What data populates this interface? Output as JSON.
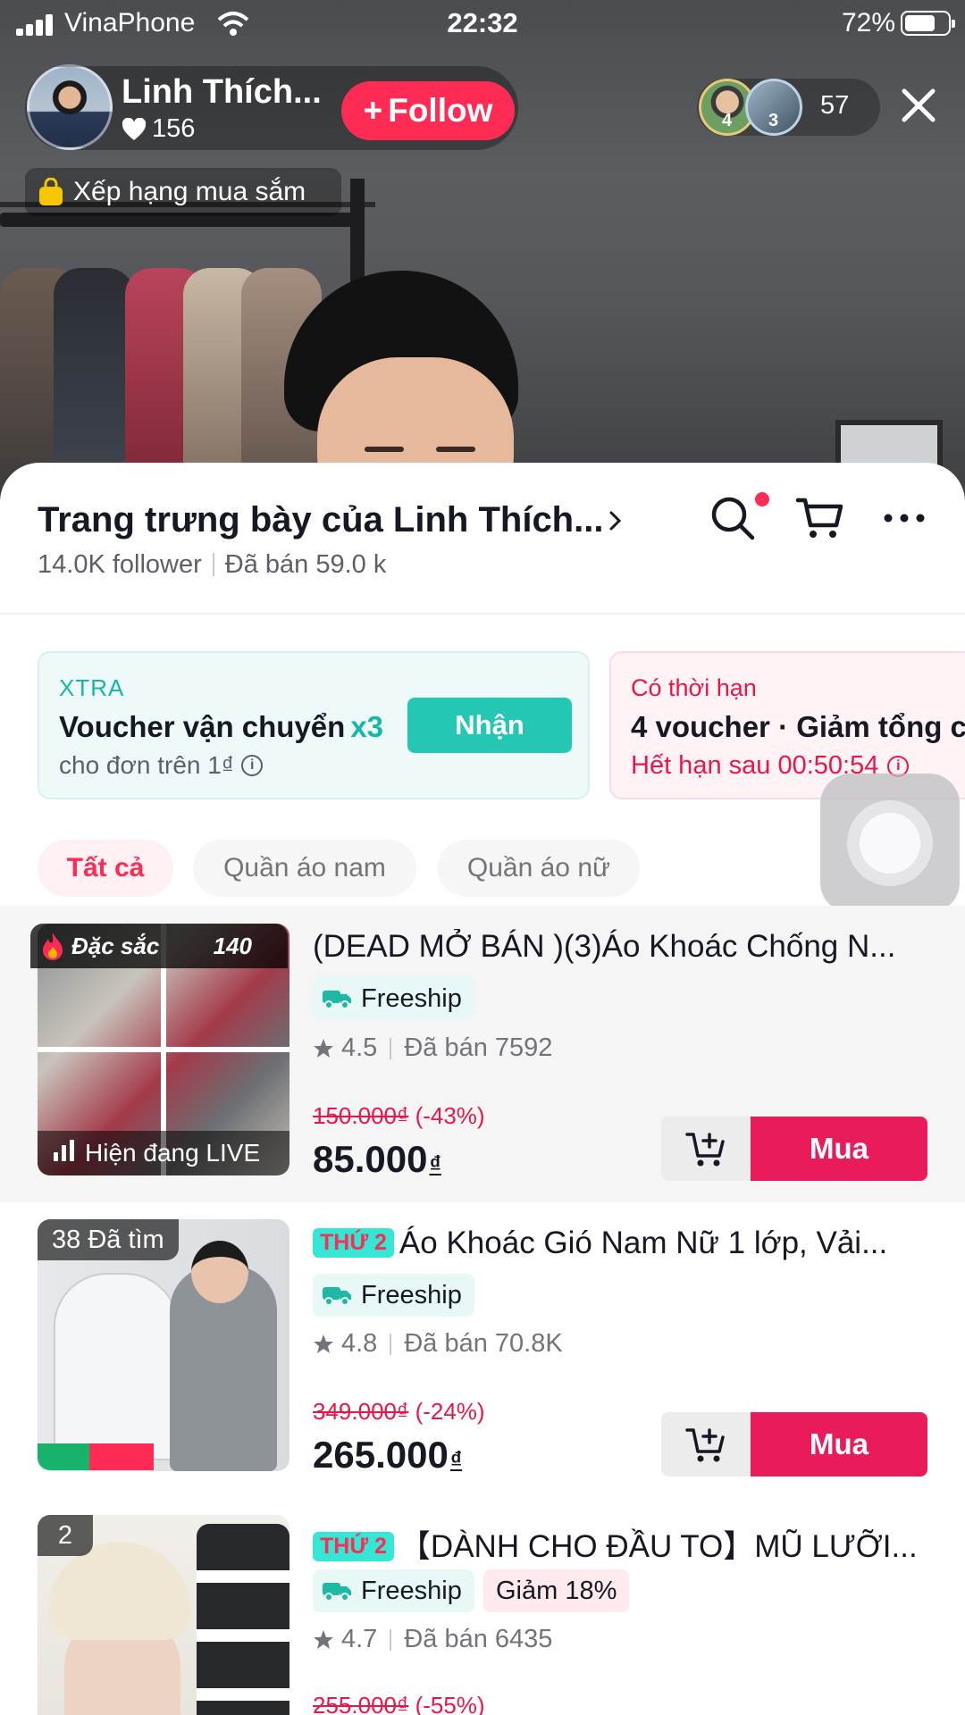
{
  "status_bar": {
    "carrier": "VinaPhone",
    "time": "22:32",
    "battery": "72%"
  },
  "live_header": {
    "host_name": "Linh Thích...",
    "likes": "156",
    "follow_label": "Follow",
    "viewer_badges": [
      "4",
      "3"
    ],
    "viewer_count": "57",
    "ranking_label": "Xếp hạng mua sắm"
  },
  "shop": {
    "title": "Trang trưng bày của Linh Thích...",
    "followers": "14.0K follower",
    "sold": "Đã bán 59.0 k"
  },
  "vouchers": [
    {
      "tag": "XTRA",
      "title": "Voucher vận chuyển",
      "multiplier": "x3",
      "subtitle": "cho đơn trên 1₫",
      "button": "Nhận"
    },
    {
      "tag": "Có thời hạn",
      "title": "4 voucher · Giảm tổng c",
      "subtitle": "Hết hạn sau 00:50:54"
    }
  ],
  "categories": [
    "Tất cả",
    "Quần áo nam",
    "Quần áo nữ"
  ],
  "products": [
    {
      "badge_label": "Đặc sắc",
      "badge_count": "140",
      "title": "(DEAD MỞ BÁN )(3)Áo Khoác Chống N...",
      "shipping": "Freeship",
      "rating": "4.5",
      "sold": "Đã bán 7592",
      "original_price": "150.000₫",
      "discount": "(-43%)",
      "price": "85.000",
      "currency": "₫",
      "live_label": "Hiện đang LIVE",
      "buy_label": "Mua"
    },
    {
      "rank_label": "38 Đã tìm",
      "promo_tag": "THỨ 2",
      "title": "Áo Khoác Gió Nam Nữ 1 lớp, Vải...",
      "shipping": "Freeship",
      "rating": "4.8",
      "sold": "Đã bán 70.8K",
      "original_price": "349.000₫",
      "discount": "(-24%)",
      "price": "265.000",
      "currency": "₫",
      "buy_label": "Mua"
    },
    {
      "rank_label": "2",
      "promo_tag": "THỨ 2",
      "title": "【DÀNH CHO ĐẦU TO】MŨ LƯỠI...",
      "shipping": "Freeship",
      "discount_chip": "Giảm 18%",
      "rating": "4.7",
      "sold": "Đã bán 6435",
      "original_price": "255.000₫",
      "discount": "(-55%)"
    }
  ],
  "colors": {
    "accent": "#fe2c55",
    "teal": "#23c7b4",
    "buy": "#ea1b5b"
  }
}
